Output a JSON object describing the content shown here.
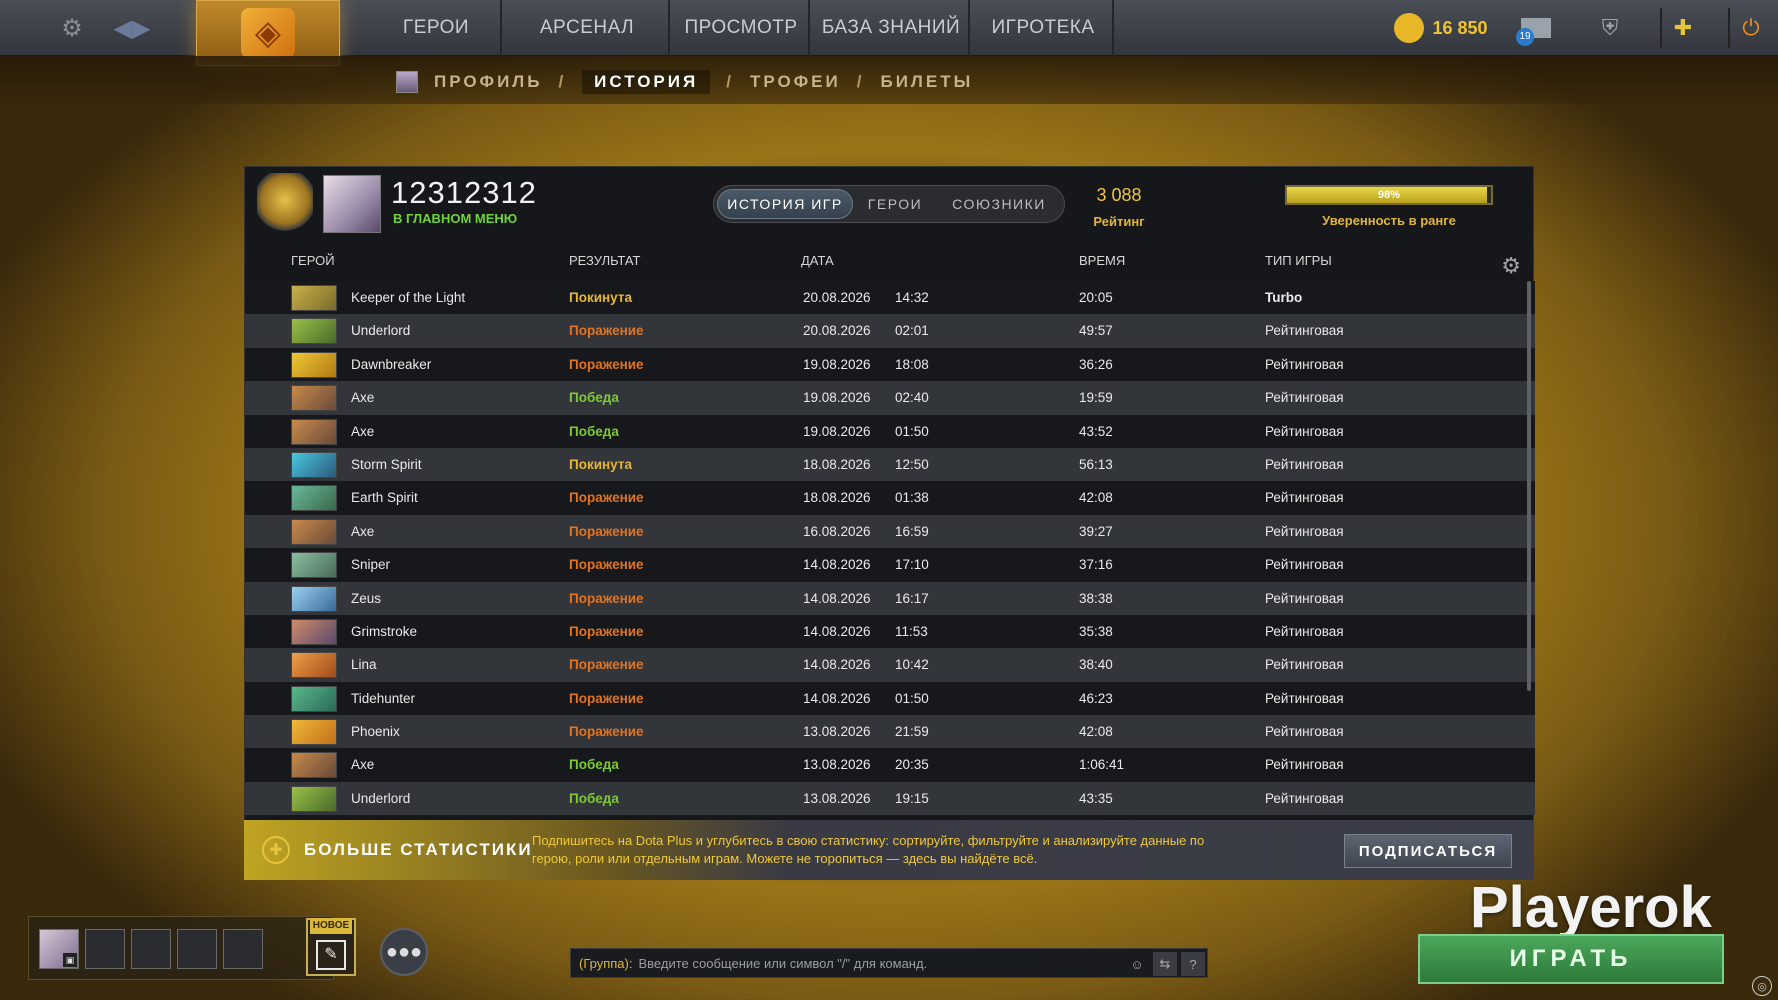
{
  "topnav": {
    "items": [
      "ГЕРОИ",
      "АРСЕНАЛ",
      "ПРОСМОТР",
      "БАЗА ЗНАНИЙ",
      "ИГРОТЕКА"
    ],
    "currency": "16 850",
    "mail_count": "19"
  },
  "breadcrumbs": [
    "ПРОФИЛЬ",
    "ИСТОРИЯ",
    "ТРОФЕИ",
    "БИЛЕТЫ"
  ],
  "breadcrumb_sep": "/",
  "profile": {
    "name": "12312312",
    "status": "В ГЛАВНОМ МЕНЮ"
  },
  "tabs": [
    "ИСТОРИЯ ИГР",
    "ГЕРОИ",
    "СОЮЗНИКИ"
  ],
  "rating": {
    "value": "3 088",
    "label": "Рейтинг"
  },
  "confidence": {
    "percent_text": "98%",
    "value": 0.98,
    "label": "Уверенность в ранге"
  },
  "columns": {
    "hero": "ГЕРОЙ",
    "result": "РЕЗУЛЬТАТ",
    "date": "ДАТА",
    "time": "ВРЕМЯ",
    "type": "ТИП ИГРЫ"
  },
  "matches": [
    {
      "hero": "Keeper of the Light",
      "result": "Покинута",
      "rclass": "aband",
      "date": "20.08.2026",
      "clock": "14:32",
      "duration": "20:05",
      "type": "Turbo",
      "c1": "#c8b04a",
      "c2": "#7a6a2a"
    },
    {
      "hero": "Underlord",
      "result": "Поражение",
      "rclass": "loss",
      "date": "20.08.2026",
      "clock": "02:01",
      "duration": "49:57",
      "type": "Рейтинговая",
      "c1": "#9ac048",
      "c2": "#4a6a2a"
    },
    {
      "hero": "Dawnbreaker",
      "result": "Поражение",
      "rclass": "loss",
      "date": "19.08.2026",
      "clock": "18:08",
      "duration": "36:26",
      "type": "Рейтинговая",
      "c1": "#f0c838",
      "c2": "#b07a10"
    },
    {
      "hero": "Axe",
      "result": "Победа",
      "rclass": "win",
      "date": "19.08.2026",
      "clock": "02:40",
      "duration": "19:59",
      "type": "Рейтинговая",
      "c1": "#c88a4a",
      "c2": "#6a4a3a"
    },
    {
      "hero": "Axe",
      "result": "Победа",
      "rclass": "win",
      "date": "19.08.2026",
      "clock": "01:50",
      "duration": "43:52",
      "type": "Рейтинговая",
      "c1": "#c88a4a",
      "c2": "#6a4a3a"
    },
    {
      "hero": "Storm Spirit",
      "result": "Покинута",
      "rclass": "aband",
      "date": "18.08.2026",
      "clock": "12:50",
      "duration": "56:13",
      "type": "Рейтинговая",
      "c1": "#4ac8e0",
      "c2": "#2a5a7a"
    },
    {
      "hero": "Earth Spirit",
      "result": "Поражение",
      "rclass": "loss",
      "date": "18.08.2026",
      "clock": "01:38",
      "duration": "42:08",
      "type": "Рейтинговая",
      "c1": "#6ab89a",
      "c2": "#3a6a4a"
    },
    {
      "hero": "Axe",
      "result": "Поражение",
      "rclass": "loss",
      "date": "16.08.2026",
      "clock": "16:59",
      "duration": "39:27",
      "type": "Рейтинговая",
      "c1": "#c88a4a",
      "c2": "#6a4a3a"
    },
    {
      "hero": "Sniper",
      "result": "Поражение",
      "rclass": "loss",
      "date": "14.08.2026",
      "clock": "17:10",
      "duration": "37:16",
      "type": "Рейтинговая",
      "c1": "#8ac0a0",
      "c2": "#4a6a5a"
    },
    {
      "hero": "Zeus",
      "result": "Поражение",
      "rclass": "loss",
      "date": "14.08.2026",
      "clock": "16:17",
      "duration": "38:38",
      "type": "Рейтинговая",
      "c1": "#9ad0f0",
      "c2": "#3a6a9a"
    },
    {
      "hero": "Grimstroke",
      "result": "Поражение",
      "rclass": "loss",
      "date": "14.08.2026",
      "clock": "11:53",
      "duration": "35:38",
      "type": "Рейтинговая",
      "c1": "#d08a6a",
      "c2": "#5a4a6a"
    },
    {
      "hero": "Lina",
      "result": "Поражение",
      "rclass": "loss",
      "date": "14.08.2026",
      "clock": "10:42",
      "duration": "38:40",
      "type": "Рейтинговая",
      "c1": "#f0a048",
      "c2": "#a04a1a"
    },
    {
      "hero": "Tidehunter",
      "result": "Поражение",
      "rclass": "loss",
      "date": "14.08.2026",
      "clock": "01:50",
      "duration": "46:23",
      "type": "Рейтинговая",
      "c1": "#5ab88a",
      "c2": "#2a6a5a"
    },
    {
      "hero": "Phoenix",
      "result": "Поражение",
      "rclass": "loss",
      "date": "13.08.2026",
      "clock": "21:59",
      "duration": "42:08",
      "type": "Рейтинговая",
      "c1": "#f0b838",
      "c2": "#c0701a"
    },
    {
      "hero": "Axe",
      "result": "Победа",
      "rclass": "win",
      "date": "13.08.2026",
      "clock": "20:35",
      "duration": "1:06:41",
      "type": "Рейтинговая",
      "c1": "#c88a4a",
      "c2": "#6a4a3a"
    },
    {
      "hero": "Underlord",
      "result": "Победа",
      "rclass": "win",
      "date": "13.08.2026",
      "clock": "19:15",
      "duration": "43:35",
      "type": "Рейтинговая",
      "c1": "#9ac048",
      "c2": "#4a6a2a"
    }
  ],
  "promo": {
    "title": "БОЛЬШЕ СТАТИСТИКИ",
    "text": "Подпишитесь на Dota Plus и углубитесь в свою статистику: сортируйте, фильтруйте и анализируйте данные по герою, роли или отдельным играм. Можете не торопиться — здесь вы найдёте всё.",
    "button": "ПОДПИСАТЬСЯ"
  },
  "new_badge": "НОВОЕ",
  "chat": {
    "group": "(Группа):",
    "placeholder": "Введите сообщение или символ \"/\" для команд."
  },
  "watermark": "Playerok",
  "play_button": "ИГРАТЬ"
}
